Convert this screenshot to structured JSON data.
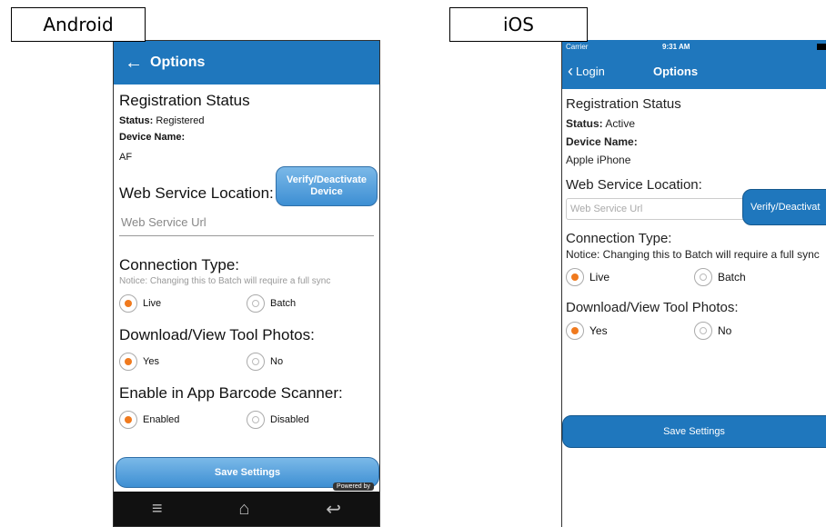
{
  "labels": {
    "android": "Android",
    "ios": "iOS"
  },
  "android": {
    "appbar": {
      "back_icon": "arrow-left-icon",
      "title": "Options"
    },
    "registration": {
      "heading": "Registration Status",
      "status_label": "Status:",
      "status_value": "Registered",
      "device_name_label": "Device Name:",
      "device_name_value": "AF",
      "verify_button": "Verify/Deactivate Device"
    },
    "web_service": {
      "heading": "Web Service Location:",
      "placeholder": "Web Service Url"
    },
    "connection": {
      "heading": "Connection Type:",
      "notice": "Notice: Changing this to Batch will require a full sync",
      "options": [
        "Live",
        "Batch"
      ],
      "selected": "Live"
    },
    "photos": {
      "heading": "Download/View Tool Photos:",
      "options": [
        "Yes",
        "No"
      ],
      "selected": "Yes"
    },
    "barcode": {
      "heading": "Enable in App Barcode Scanner:",
      "options": [
        "Enabled",
        "Disabled"
      ],
      "selected": "Enabled"
    },
    "save_button": "Save Settings",
    "powered_by": "Powered by",
    "navbar_icons": [
      "menu-icon",
      "home-icon",
      "back-icon"
    ]
  },
  "ios": {
    "status_bar": {
      "carrier": "Carrier",
      "time": "9:31 AM"
    },
    "nav": {
      "back_label": "Login",
      "title": "Options"
    },
    "registration": {
      "heading": "Registration Status",
      "status_label": "Status:",
      "status_value": "Active",
      "device_name_label": "Device Name:",
      "device_name_value": "Apple iPhone",
      "verify_button": "Verify/Deactivat"
    },
    "web_service": {
      "heading": "Web Service Location:",
      "placeholder": "Web Service Url"
    },
    "connection": {
      "heading": "Connection Type:",
      "notice": "Notice: Changing this to Batch will require a full sync",
      "options": [
        "Live",
        "Batch"
      ],
      "selected": "Live"
    },
    "photos": {
      "heading": "Download/View Tool Photos:",
      "options": [
        "Yes",
        "No"
      ],
      "selected": "Yes"
    },
    "save_button": "Save Settings"
  },
  "colors": {
    "brand_blue": "#1f77bd",
    "radio_selected": "#f07a1e"
  }
}
